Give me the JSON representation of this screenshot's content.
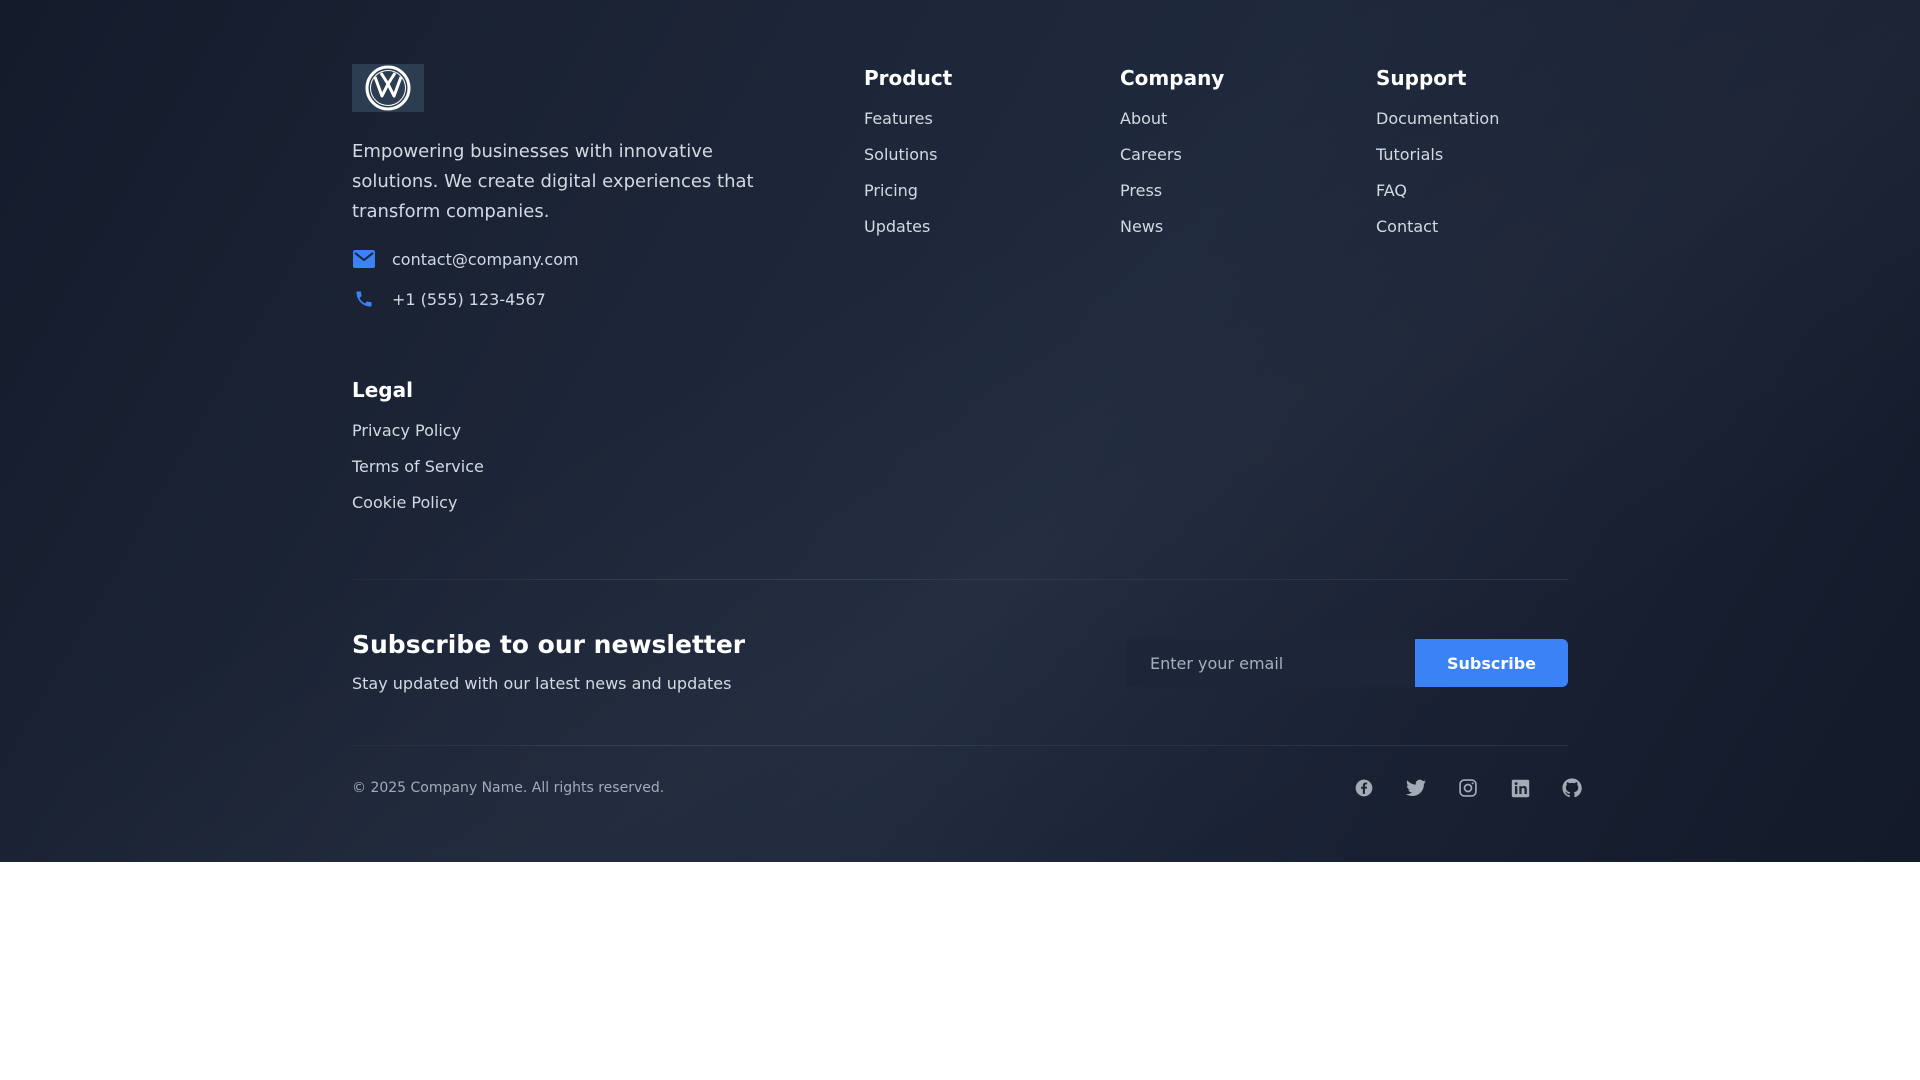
{
  "brand": {
    "logo_name": "vw-logo",
    "tagline": "Empowering businesses with innovative solutions. We create digital experiences that transform companies.",
    "email": "contact@company.com",
    "phone": "+1 (555) 123-4567",
    "email_icon": "mail-icon",
    "phone_icon": "phone-icon"
  },
  "columns": {
    "product": {
      "title": "Product",
      "links": [
        "Features",
        "Solutions",
        "Pricing",
        "Updates"
      ]
    },
    "company": {
      "title": "Company",
      "links": [
        "About",
        "Careers",
        "Press",
        "News"
      ]
    },
    "support": {
      "title": "Support",
      "links": [
        "Documentation",
        "Tutorials",
        "FAQ",
        "Contact"
      ]
    },
    "legal": {
      "title": "Legal",
      "links": [
        "Privacy Policy",
        "Terms of Service",
        "Cookie Policy"
      ]
    }
  },
  "newsletter": {
    "title": "Subscribe to our newsletter",
    "subtitle": "Stay updated with our latest news and updates",
    "placeholder": "Enter your email",
    "button_label": "Subscribe"
  },
  "bottom": {
    "copyright": "© 2025 Company Name. All rights reserved.",
    "social_icons": [
      "facebook-icon",
      "twitter-icon",
      "instagram-icon",
      "linkedin-icon",
      "github-icon"
    ]
  },
  "colors": {
    "accent": "#3b82f6",
    "background": "#1d2638",
    "text": "#d4d9e1",
    "heading": "#ffffff",
    "muted": "#a3abb7"
  }
}
